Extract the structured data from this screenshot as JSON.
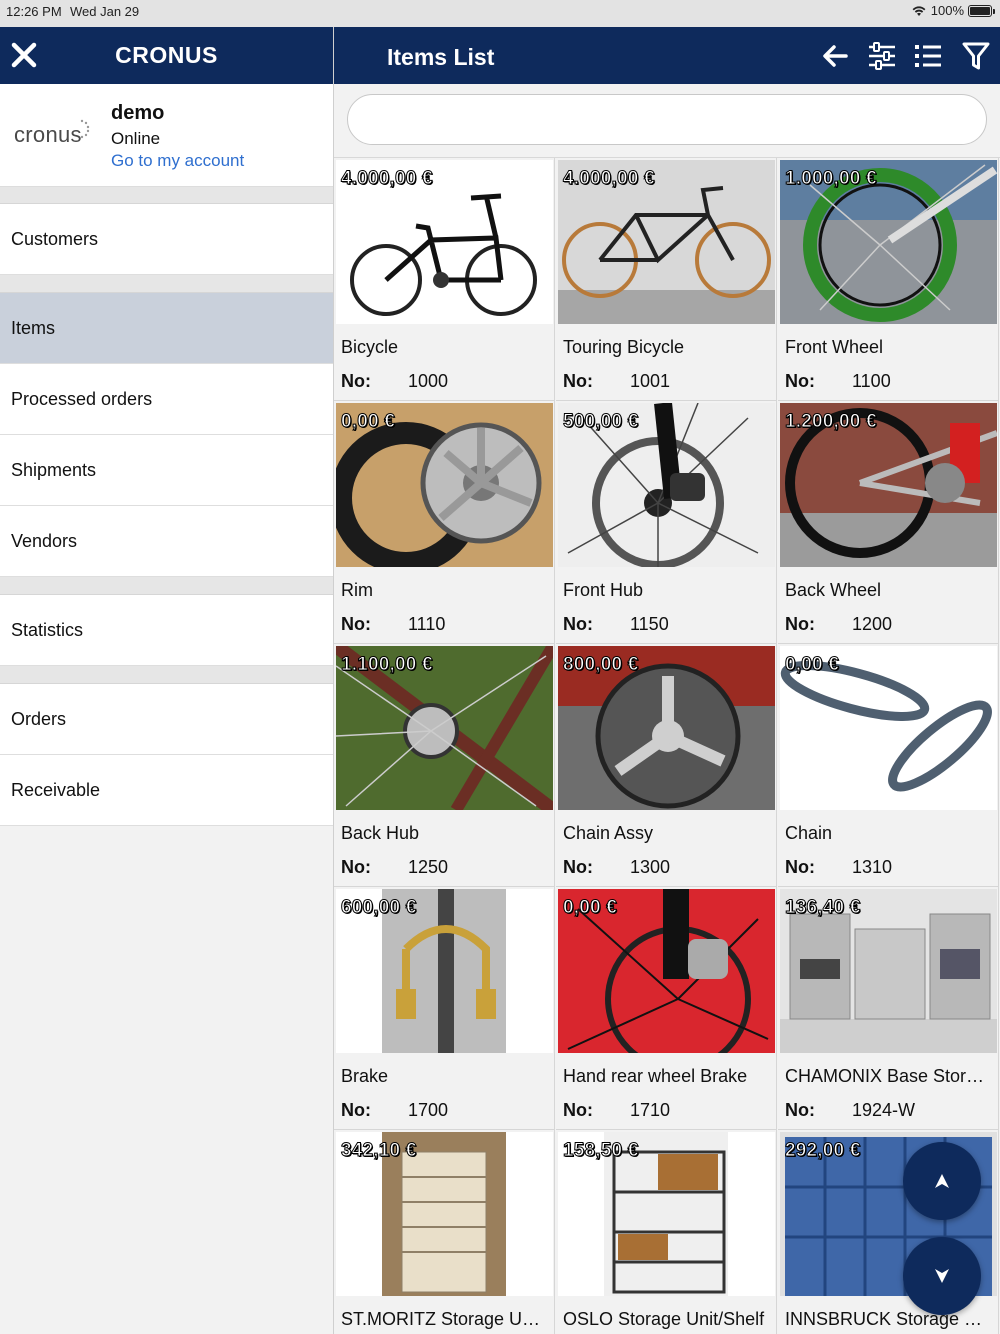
{
  "status": {
    "time": "12:26 PM",
    "date": "Wed Jan 29",
    "battery": "100%",
    "battery_level": 1.0
  },
  "sidebar": {
    "title": "CRONUS",
    "logo_text": "cronus",
    "account": {
      "user": "demo",
      "status": "Online",
      "link": "Go to my account"
    },
    "items": [
      "Customers",
      "Items",
      "Processed orders",
      "Shipments",
      "Vendors",
      "Statistics",
      "Orders",
      "Receivable"
    ],
    "active_item": "Items"
  },
  "header": {
    "title": "Items List"
  },
  "search": {
    "value": "",
    "placeholder": ""
  },
  "items_labels": {
    "no_label": "No:"
  },
  "items": [
    {
      "price": "4.000,00 €",
      "name": "Bicycle",
      "no": "1000",
      "image": "bicycle"
    },
    {
      "price": "4.000,00 €",
      "name": "Touring Bicycle",
      "no": "1001",
      "image": "touring-bicycle"
    },
    {
      "price": "1.000,00 €",
      "name": "Front Wheel",
      "no": "1100",
      "image": "front-wheel"
    },
    {
      "price": "0,00 €",
      "name": "Rim",
      "no": "1110",
      "image": "rim"
    },
    {
      "price": "500,00 €",
      "name": "Front Hub",
      "no": "1150",
      "image": "front-hub"
    },
    {
      "price": "1.200,00 €",
      "name": "Back Wheel",
      "no": "1200",
      "image": "back-wheel"
    },
    {
      "price": "1.100,00 €",
      "name": "Back Hub",
      "no": "1250",
      "image": "back-hub"
    },
    {
      "price": "800,00 €",
      "name": "Chain Assy",
      "no": "1300",
      "image": "chain-assy"
    },
    {
      "price": "0,00 €",
      "name": "Chain",
      "no": "1310",
      "image": "chain"
    },
    {
      "price": "600,00 €",
      "name": "Brake",
      "no": "1700",
      "image": "brake"
    },
    {
      "price": "0,00 €",
      "name": "Hand rear wheel Brake",
      "no": "1710",
      "image": "hand-brake"
    },
    {
      "price": "136,40 €",
      "name": "CHAMONIX Base Stor…",
      "no": "1924-W",
      "image": "storage"
    },
    {
      "price": "342,10 €",
      "name": "ST.MORITZ Storage U…",
      "no": "",
      "image": "drawers"
    },
    {
      "price": "158,50 €",
      "name": "OSLO Storage Unit/Shelf",
      "no": "",
      "image": "shelf"
    },
    {
      "price": "292,00 €",
      "name": "INNSBRUCK Storage …",
      "no": "",
      "image": "lockers"
    }
  ],
  "colors": {
    "brand": "#0e2a5c",
    "active_menu": "#c9d0db",
    "link": "#2f6fcf"
  }
}
